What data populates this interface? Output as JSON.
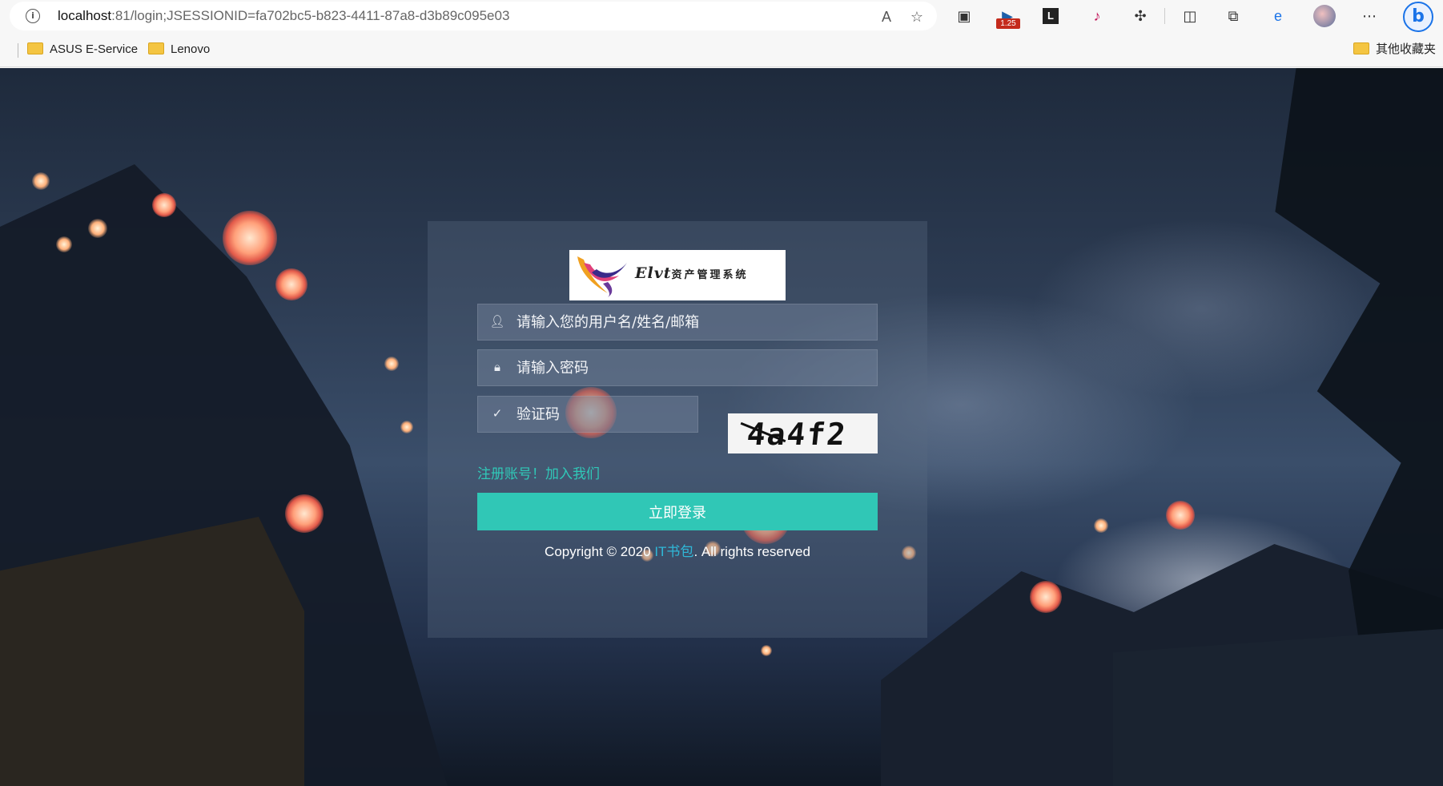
{
  "browser": {
    "url_host": "localhost",
    "url_rest": ":81/login;JSESSIONID=fa702bc5-b823-4411-87a8-d3b89c095e03",
    "extension_badge": "1.25",
    "bookmarks": [
      {
        "label": "ASUS E-Service",
        "icon": "folder-icon"
      },
      {
        "label": "Lenovo",
        "icon": "folder-icon"
      }
    ],
    "other_bookmarks": "其他收藏夹"
  },
  "login": {
    "logo_title": "Elvt",
    "logo_subtitle": "资产管理系统",
    "username_placeholder": "请输入您的用户名/姓名/邮箱",
    "password_placeholder": "请输入密码",
    "captcha_placeholder": "验证码",
    "captcha_value": "4a4f2",
    "register_text": "注册账号！",
    "join_text": "加入我们",
    "login_button": "立即登录",
    "copyright_prefix": "Copyright © 2020 ",
    "copyright_brand": "IT书包",
    "copyright_suffix": ". All rights reserved"
  },
  "colors": {
    "accent": "#30c7b6",
    "link": "#30c8b8",
    "brand_link": "#2fb8d8"
  }
}
